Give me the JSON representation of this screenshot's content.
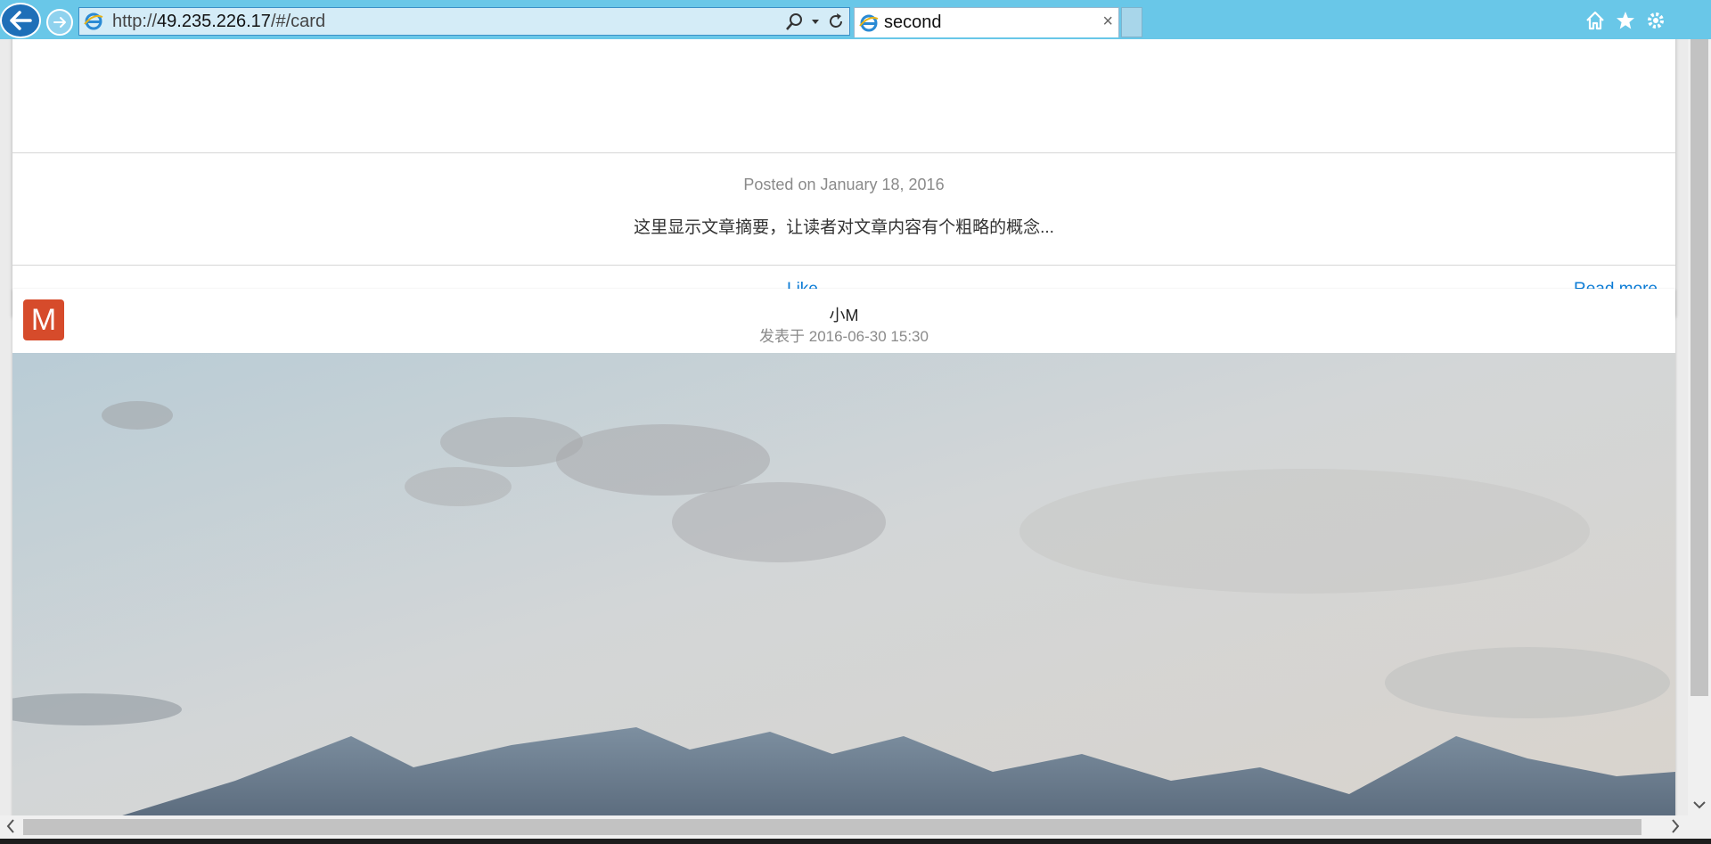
{
  "browser": {
    "url_prefix": "http://",
    "url_host": "49.235.226.17",
    "url_path": "/#/card",
    "tab_title": "second",
    "tab_close": "×"
  },
  "card1": {
    "posted": "Posted on January 18, 2016",
    "summary": "这里显示文章摘要，让读者对文章内容有个粗略的概念...",
    "like_label": "Like",
    "read_more_label": "Read more"
  },
  "card2": {
    "avatar_letter": "M",
    "author": "小M",
    "date": "发表于 2016-06-30 15:30"
  },
  "colors": {
    "chrome": "#69c7e8",
    "link": "#0a7bd6",
    "avatar": "#d64b2b"
  },
  "icons": [
    "back-arrow-icon",
    "forward-arrow-icon",
    "ie-logo-icon",
    "search-icon",
    "dropdown-icon",
    "refresh-icon",
    "home-icon",
    "favorites-star-icon",
    "settings-gear-icon"
  ]
}
